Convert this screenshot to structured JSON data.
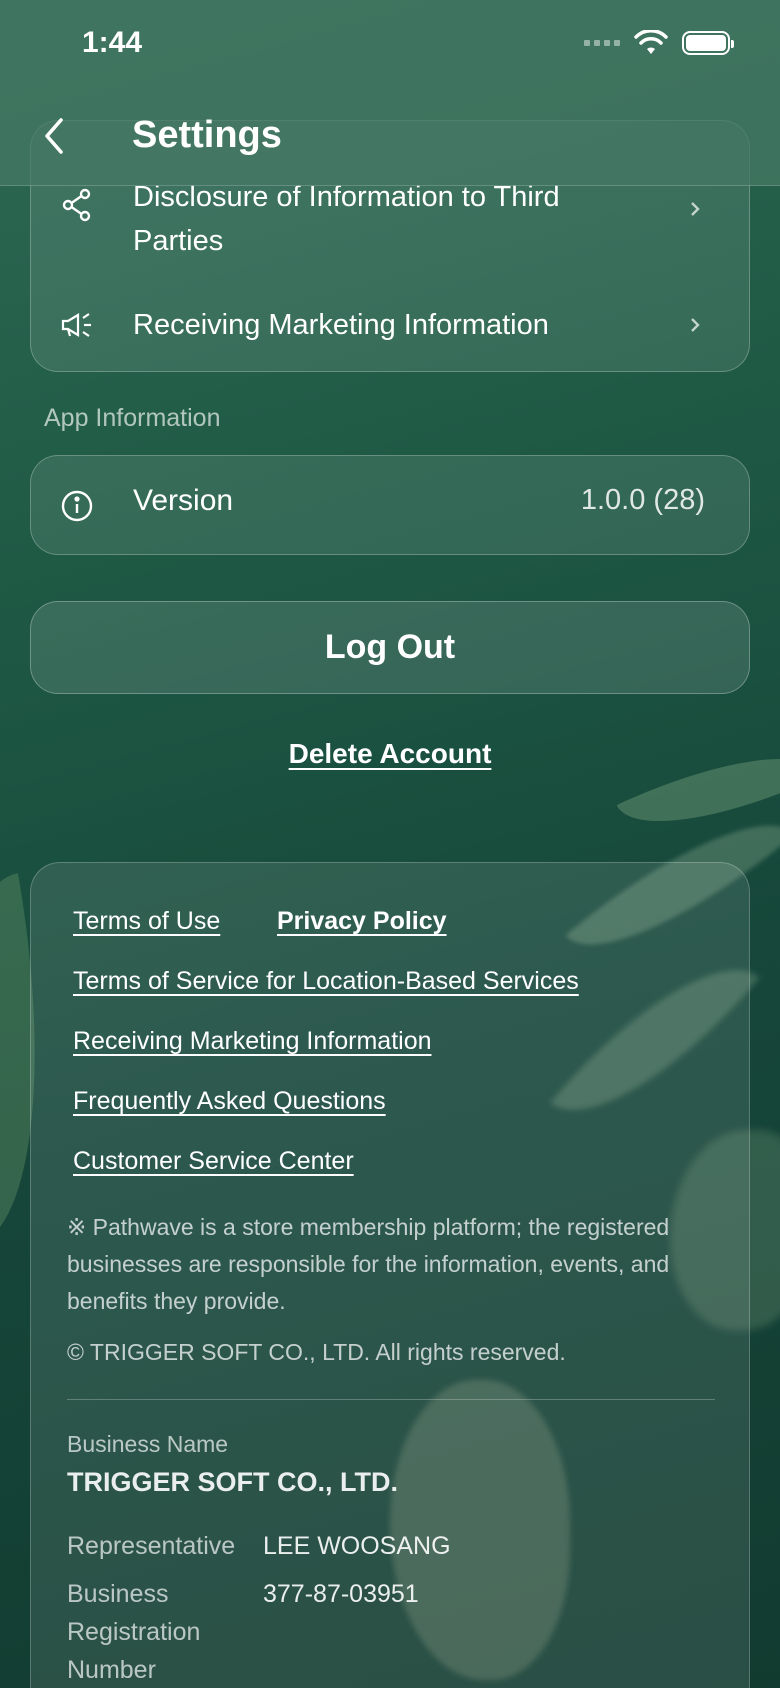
{
  "status_bar": {
    "time": "1:44"
  },
  "header": {
    "title": "Settings"
  },
  "privacy_section": {
    "items": [
      {
        "label": "Disclosure of Information to Third Parties",
        "icon": "share-icon"
      },
      {
        "label": "Receiving Marketing Information",
        "icon": "megaphone-icon"
      }
    ]
  },
  "app_info": {
    "section_label": "App Information",
    "version_label": "Version",
    "version_value": "1.0.0 (28)"
  },
  "actions": {
    "logout_label": "Log Out",
    "delete_label": "Delete Account"
  },
  "footer": {
    "links": {
      "terms_of_use": "Terms of Use",
      "privacy_policy": "Privacy Policy",
      "location_terms": "Terms of Service for Location-Based Services",
      "marketing": "Receiving Marketing Information",
      "faq": "Frequently Asked Questions",
      "customer_service": "Customer Service Center"
    },
    "notice": "※ Pathwave is a store membership platform; the registered businesses are responsible for the information, events, and benefits they provide.",
    "copyright": "© TRIGGER SOFT CO., LTD. All rights reserved.",
    "business_name_label": "Business Name",
    "business_name": "TRIGGER SOFT CO., LTD.",
    "representative_label": "Representative",
    "representative": "LEE WOOSANG",
    "registration_label": "Business Registration Number",
    "registration_number": "377-87-03951"
  }
}
